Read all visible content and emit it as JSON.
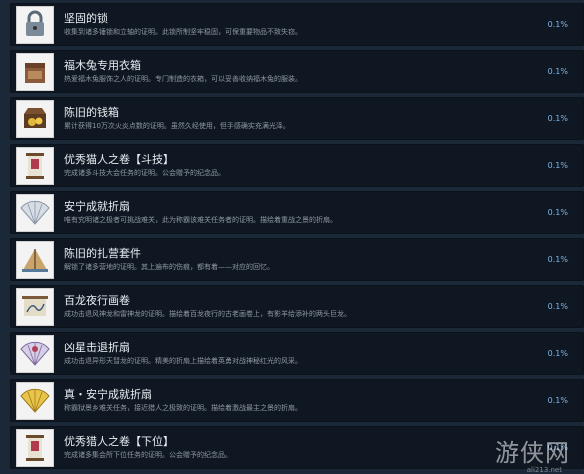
{
  "achievements": [
    {
      "title": "坚固的锁",
      "desc": "收集到诸多锤锁和立轴的证明。此锁所制坚牢稳固，可保重要物品不致失窃。",
      "percent": "0.1%",
      "icon": "lock-icon"
    },
    {
      "title": "福木兔专用衣箱",
      "desc": "热爱福木兔服饰之人的证明。专门制造的衣箱，可以妥善收纳福木兔的服装。",
      "percent": "0.1%",
      "icon": "clothes-chest-icon"
    },
    {
      "title": "陈旧的钱箱",
      "desc": "累计获得10万次火炎点数的证明。虽然久经使用，但手感确实充满光泽。",
      "percent": "0.1%",
      "icon": "money-chest-icon"
    },
    {
      "title": "优秀猫人之卷【斗技】",
      "desc": "完成诸多斗技大会任务的证明。公会赠予的纪念品。",
      "percent": "0.1%",
      "icon": "scroll-icon"
    },
    {
      "title": "安宁成就折扇",
      "desc": "唯有究明诸之极者可挑战难关，此为称霸该难关任务者的证明。描绘着重战之景的折扇。",
      "percent": "0.1%",
      "icon": "folding-fan-icon"
    },
    {
      "title": "陈旧的扎营套件",
      "desc": "解锁了诸多营地的证明。其上遍布的伤痕，都有着——对应的回忆。",
      "percent": "0.1%",
      "icon": "camp-kit-icon"
    },
    {
      "title": "百龙夜行画卷",
      "desc": "成功击退风神龙和雷神龙的证明。描绘着百龙夜行的古老画卷上，有影羊给添补的两头巨龙。",
      "percent": "0.1%",
      "icon": "painting-scroll-icon"
    },
    {
      "title": "凶星击退折扇",
      "desc": "成功击退异形天彗龙的证明。精美的折扇上描绘着英勇对战神秘红光的风采。",
      "percent": "0.1%",
      "icon": "folding-fan-icon"
    },
    {
      "title": "真・安宁成就折扇",
      "desc": "称霸狱景乡难关任务，接近猎人之极致的证明。描绘着激战最主之景的折扇。",
      "percent": "0.1%",
      "icon": "gold-fan-icon"
    },
    {
      "title": "优秀猎人之卷【下位】",
      "desc": "完成诸多集会所下位任务的证明。公会赠予的纪念品。",
      "percent": "0.1%",
      "icon": "scroll-icon"
    }
  ],
  "watermark": {
    "main": "游侠网",
    "sub": "ali213.net"
  },
  "colors": {
    "background": "#1b2838",
    "row": "#0f1822",
    "percent": "#7fb3e6"
  }
}
